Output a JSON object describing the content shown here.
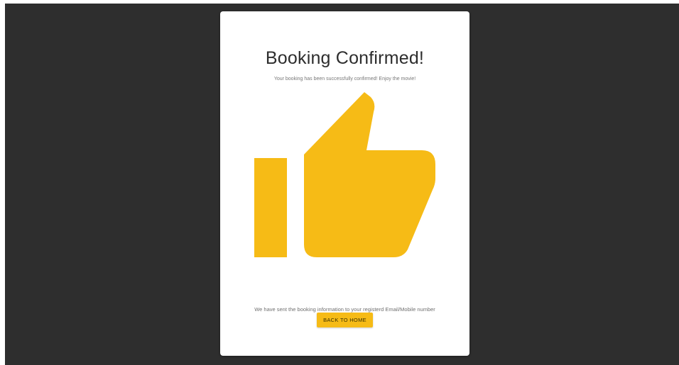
{
  "card": {
    "title": "Booking Confirmed!",
    "subtitle": "Your booking has been successfully confirmed! Enjoy the movie!",
    "info": "We have sent the booking information to your registerd Email/Mobile number",
    "button_label": "BACK TO HOME"
  },
  "icon": {
    "name": "thumbs-up-icon",
    "color": "#f6bb16"
  },
  "colors": {
    "backdrop": "#2e2e2e",
    "card": "#ffffff",
    "accent": "#f6bb16"
  }
}
